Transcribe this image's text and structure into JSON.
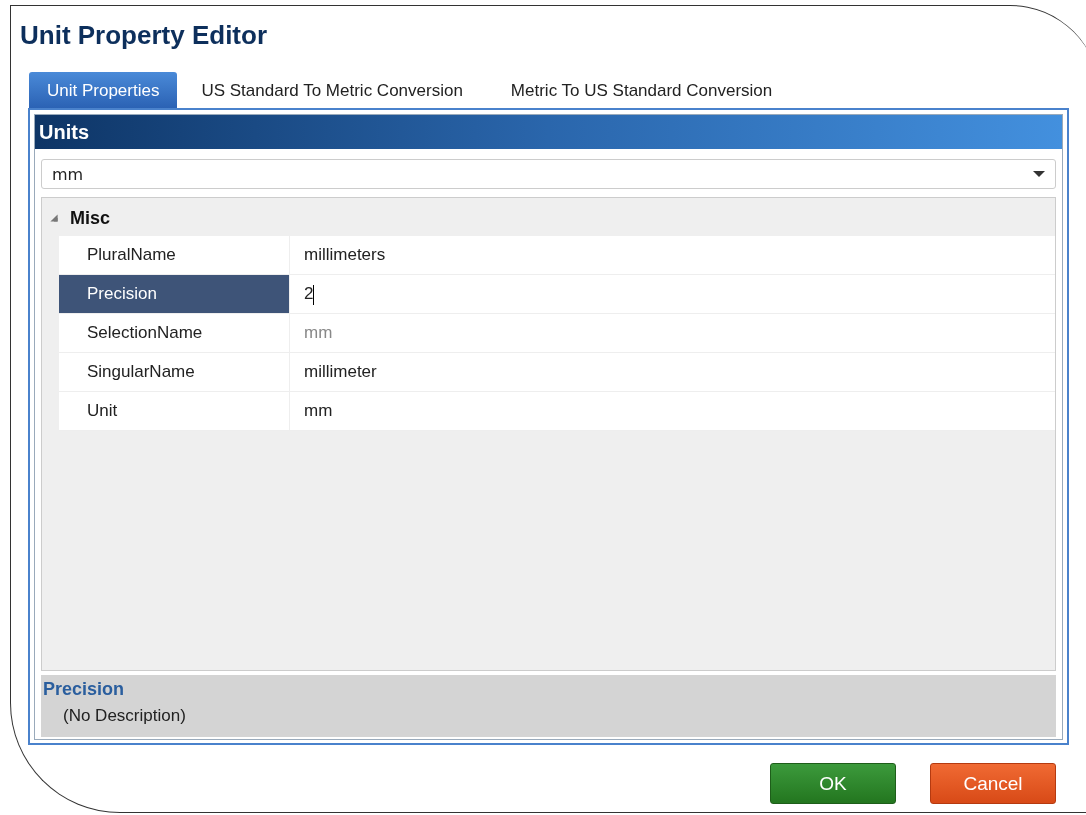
{
  "window": {
    "title": "Unit Property Editor"
  },
  "tabs": [
    {
      "label": "Unit Properties",
      "selected": true
    },
    {
      "label": "US Standard To Metric Conversion",
      "selected": false
    },
    {
      "label": "Metric To US Standard Conversion",
      "selected": false
    }
  ],
  "panel": {
    "header": "Units",
    "dropdown": {
      "value": "mm"
    }
  },
  "property_grid": {
    "categories": [
      {
        "name": "Misc",
        "expanded": true,
        "properties": [
          {
            "name": "PluralName",
            "value": "millimeters",
            "selected": false,
            "readonly": false
          },
          {
            "name": "Precision",
            "value": "2",
            "selected": true,
            "readonly": false
          },
          {
            "name": "SelectionName",
            "value": "mm",
            "selected": false,
            "readonly": true
          },
          {
            "name": "SingularName",
            "value": "millimeter",
            "selected": false,
            "readonly": false
          },
          {
            "name": "Unit",
            "value": "mm",
            "selected": false,
            "readonly": false
          }
        ]
      }
    ]
  },
  "description": {
    "title": "Precision",
    "text": "(No Description)"
  },
  "buttons": [
    {
      "label": "OK",
      "kind": "primary"
    },
    {
      "label": "Cancel",
      "kind": "cancel"
    }
  ]
}
